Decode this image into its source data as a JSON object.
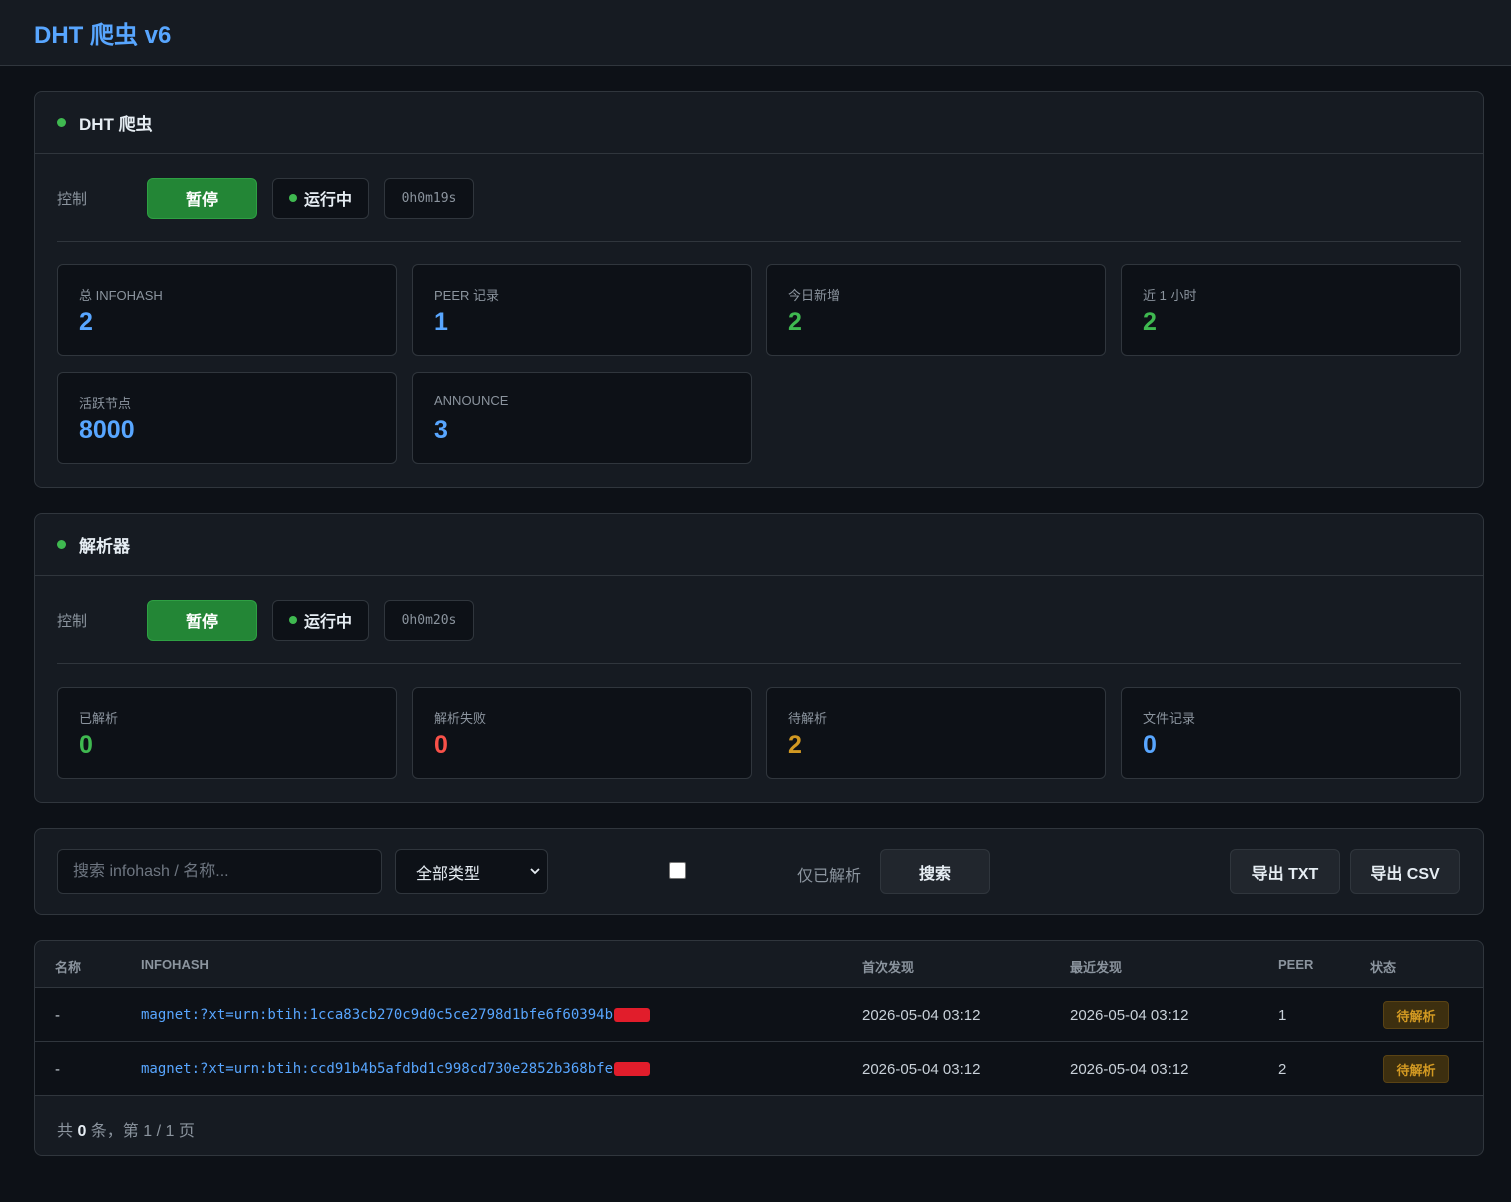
{
  "app": {
    "title": "DHT 爬虫 v6"
  },
  "crawler": {
    "title": "DHT 爬虫",
    "control_label": "控制",
    "pause_label": "暂停",
    "status_label": "运行中",
    "uptime": "0h0m19s",
    "stats": [
      {
        "label": "总 INFOHASH",
        "value": "2",
        "color": "blue"
      },
      {
        "label": "PEER 记录",
        "value": "1",
        "color": "blue"
      },
      {
        "label": "今日新增",
        "value": "2",
        "color": "green"
      },
      {
        "label": "近 1 小时",
        "value": "2",
        "color": "green"
      },
      {
        "label": "活跃节点",
        "value": "8000",
        "color": "blue"
      },
      {
        "label": "ANNOUNCE",
        "value": "3",
        "color": "blue"
      }
    ]
  },
  "parser": {
    "title": "解析器",
    "control_label": "控制",
    "pause_label": "暂停",
    "status_label": "运行中",
    "uptime": "0h0m20s",
    "stats": [
      {
        "label": "已解析",
        "value": "0",
        "color": "green"
      },
      {
        "label": "解析失败",
        "value": "0",
        "color": "red"
      },
      {
        "label": "待解析",
        "value": "2",
        "color": "orange"
      },
      {
        "label": "文件记录",
        "value": "0",
        "color": "blue"
      }
    ]
  },
  "filters": {
    "search_placeholder": "搜索 infohash / 名称...",
    "type_selected": "全部类型",
    "only_parsed_label": "仅已解析",
    "search_button": "搜索",
    "export_txt": "导出 TXT",
    "export_csv": "导出 CSV"
  },
  "table": {
    "headers": [
      "名称",
      "INFOHASH",
      "首次发现",
      "最近发现",
      "PEER",
      "状态"
    ],
    "rows": [
      {
        "name": "-",
        "infohash": "magnet:?xt=urn:btih:1cca83cb270c9d0c5ce2798d1bfe6f60394b",
        "first_seen": "2026-05-04 03:12",
        "last_seen": "2026-05-04 03:12",
        "peer": "1",
        "status": "待解析"
      },
      {
        "name": "-",
        "infohash": "magnet:?xt=urn:btih:ccd91b4b5afdbd1c998cd730e2852b368bfe",
        "first_seen": "2026-05-04 03:12",
        "last_seen": "2026-05-04 03:12",
        "peer": "2",
        "status": "待解析"
      }
    ],
    "footer": {
      "prefix": "共 ",
      "count": "0",
      "suffix": " 条，第 1 / 1 页"
    }
  },
  "colors": {
    "blue": "#58a6ff",
    "green": "#3fb950",
    "red": "#f85149",
    "orange": "#d29922",
    "accent_button": "#238636"
  }
}
